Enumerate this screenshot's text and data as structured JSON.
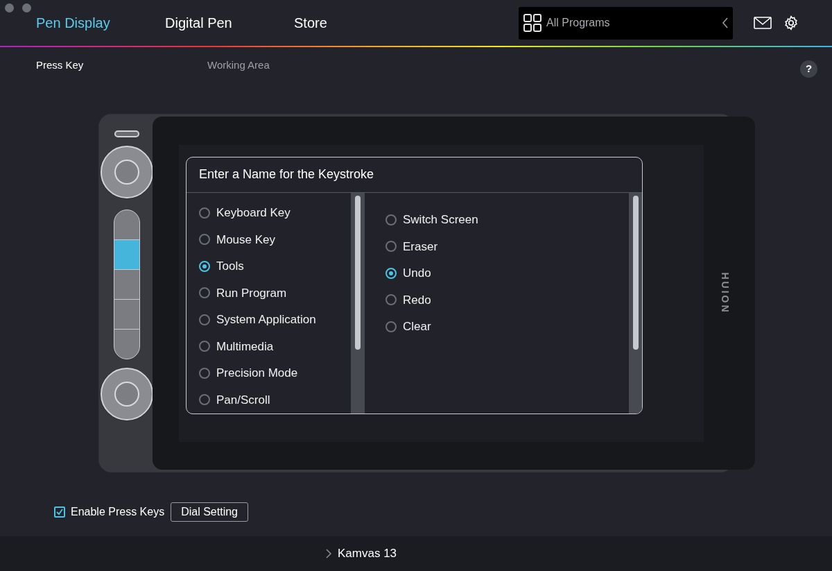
{
  "tabs": [
    {
      "label": "Pen Display",
      "selected": true
    },
    {
      "label": "Digital Pen",
      "selected": false
    },
    {
      "label": "Store",
      "selected": false
    }
  ],
  "program_selector": {
    "label": "All Programs"
  },
  "subtabs": [
    {
      "label": "Press Key",
      "selected": true
    },
    {
      "label": "Working Area",
      "selected": false
    }
  ],
  "help": "?",
  "device": {
    "brand": "HUION",
    "express_keys": [
      {
        "selected": false
      },
      {
        "selected": true
      },
      {
        "selected": false
      },
      {
        "selected": false
      },
      {
        "selected": false
      }
    ]
  },
  "dialog": {
    "title": "Enter a Name for the Keystroke",
    "categories": [
      {
        "label": "Keyboard Key",
        "selected": false
      },
      {
        "label": "Mouse Key",
        "selected": false
      },
      {
        "label": "Tools",
        "selected": true
      },
      {
        "label": "Run Program",
        "selected": false
      },
      {
        "label": "System Application",
        "selected": false
      },
      {
        "label": "Multimedia",
        "selected": false
      },
      {
        "label": "Precision Mode",
        "selected": false
      },
      {
        "label": "Pan/Scroll",
        "selected": false
      }
    ],
    "options": [
      {
        "label": "Switch Screen",
        "selected": false
      },
      {
        "label": "Eraser",
        "selected": false
      },
      {
        "label": "Undo",
        "selected": true
      },
      {
        "label": "Redo",
        "selected": false
      },
      {
        "label": "Clear",
        "selected": false
      }
    ]
  },
  "enable_press_keys": {
    "label": "Enable Press Keys",
    "checked": true
  },
  "dial_setting": "Dial Setting",
  "footer": {
    "device": "Kamvas 13"
  }
}
